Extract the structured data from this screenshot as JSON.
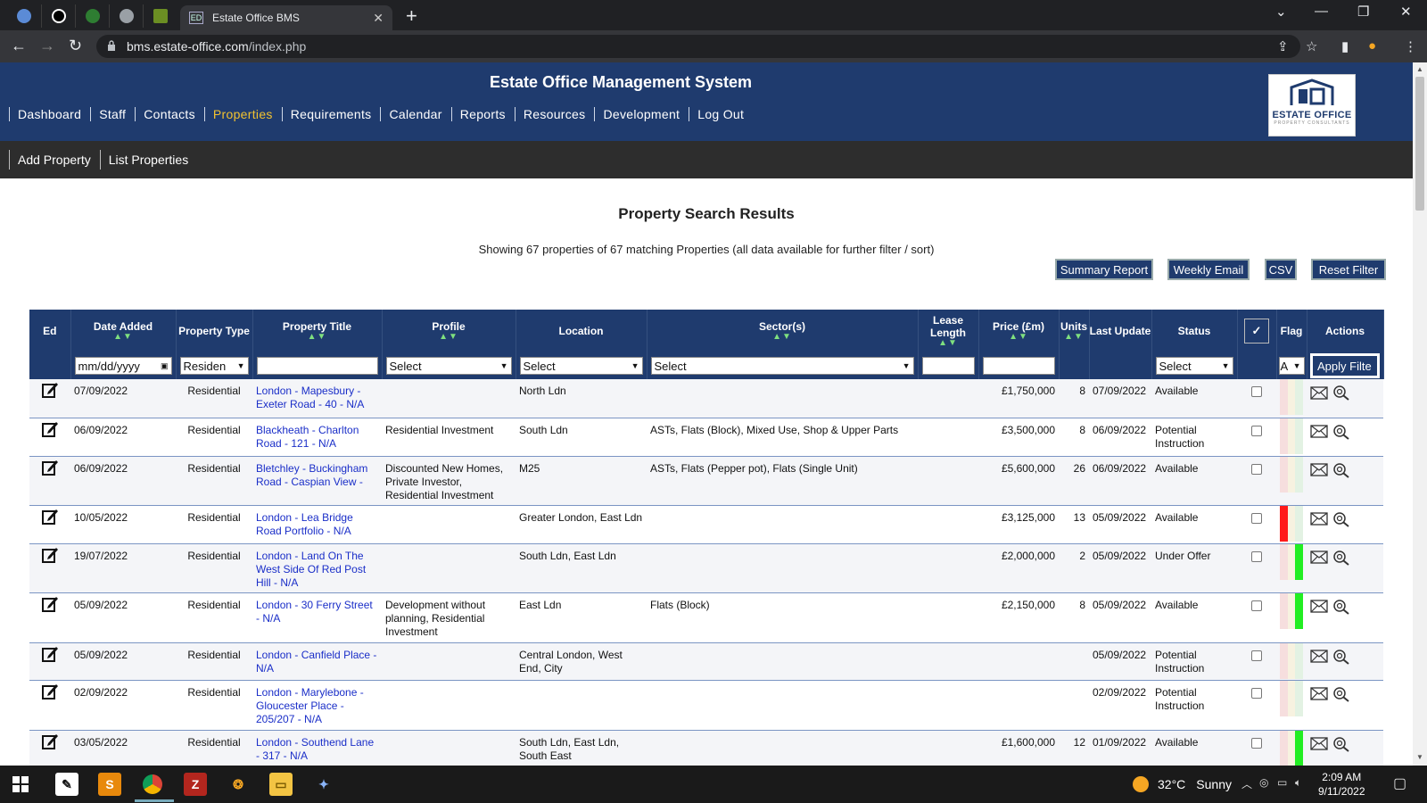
{
  "browser": {
    "active_tab_title": "Estate Office BMS",
    "url_host": "bms.estate-office.com",
    "url_path": "/index.php",
    "pinned_tabs": [
      "tab-1",
      "tab-2",
      "tab-3",
      "tab-4",
      "tab-5"
    ]
  },
  "site": {
    "title": "Estate Office Management System",
    "logo_text": "ESTATE OFFICE",
    "logo_subtext": "PROPERTY CONSULTANTS",
    "nav": [
      "Dashboard",
      "Staff",
      "Contacts",
      "Properties",
      "Requirements",
      "Calendar",
      "Reports",
      "Resources",
      "Development",
      "Log Out"
    ],
    "nav_active": "Properties",
    "subnav": [
      "Add Property",
      "List Properties"
    ]
  },
  "results": {
    "title": "Property Search Results",
    "summary": "Showing 67 properties of 67 matching Properties (all data available for further filter / sort)",
    "buttons": {
      "summary_report": "Summary Report",
      "weekly_email": "Weekly Email",
      "csv": "CSV",
      "reset_filter": "Reset Filter"
    }
  },
  "table": {
    "headers": {
      "ed": "Ed",
      "date_added": "Date Added",
      "property_type": "Property Type",
      "property_title": "Property Title",
      "profile": "Profile",
      "location": "Location",
      "sectors": "Sector(s)",
      "lease_length": "Lease Length",
      "price": "Price (£m)",
      "units": "Units",
      "last_update": "Last Update",
      "status": "Status",
      "check_all": "✓",
      "flag": "Flag",
      "actions": "Actions"
    },
    "sort_arrows": "▲▼",
    "filters": {
      "date_placeholder": "mm/dd/yyyy",
      "property_type_value": "Residen",
      "profile_value": "Select",
      "location_value": "Select",
      "sectors_value": "Select",
      "status_value": "Select",
      "flag_value": "A",
      "apply_label": "Apply Filte"
    },
    "rows": [
      {
        "date": "07/09/2022",
        "type": "Residential",
        "title": "London - Mapesbury - Exeter Road - 40 - N/A",
        "profile": "",
        "location": "North Ldn",
        "sectors": "",
        "price": "£1,750,000",
        "units": "8",
        "last_update": "07/09/2022",
        "status": "Available",
        "flag_colors": [
          "#f6dede",
          "#f7f2e0",
          "#e3f2e3"
        ]
      },
      {
        "date": "06/09/2022",
        "type": "Residential",
        "title": "Blackheath - Charlton Road - 121 - N/A",
        "profile": "Residential Investment",
        "location": "South Ldn",
        "sectors": "ASTs, Flats (Block), Mixed Use, Shop & Upper Parts",
        "price": "£3,500,000",
        "units": "8",
        "last_update": "06/09/2022",
        "status": "Potential Instruction",
        "flag_colors": [
          "#f6dede",
          "#f7f2e0",
          "#e3f2e3"
        ]
      },
      {
        "date": "06/09/2022",
        "type": "Residential",
        "title": "Bletchley - Buckingham Road - Caspian View -",
        "profile": "Discounted New Homes, Private Investor, Residential Investment",
        "location": "M25",
        "sectors": "ASTs, Flats (Pepper pot), Flats (Single Unit)",
        "price": "£5,600,000",
        "units": "26",
        "last_update": "06/09/2022",
        "status": "Available",
        "flag_colors": [
          "#f6dede",
          "#f7f2e0",
          "#e3f2e3"
        ]
      },
      {
        "date": "10/05/2022",
        "type": "Residential",
        "title": "London - Lea Bridge Road Portfolio - N/A",
        "profile": "",
        "location": "Greater London, East Ldn",
        "sectors": "",
        "price": "£3,125,000",
        "units": "13",
        "last_update": "05/09/2022",
        "status": "Available",
        "flag_colors": [
          "#ff1a1a",
          "#f7f2e0",
          "#e3f2e3"
        ]
      },
      {
        "date": "19/07/2022",
        "type": "Residential",
        "title": "London - Land On The West Side Of Red Post Hill - N/A",
        "profile": "",
        "location": "South Ldn, East Ldn",
        "sectors": "",
        "price": "£2,000,000",
        "units": "2",
        "last_update": "05/09/2022",
        "status": "Under Offer",
        "flag_colors": [
          "#f6dede",
          "#f7f2e0",
          "#22ee22"
        ]
      },
      {
        "date": "05/09/2022",
        "type": "Residential",
        "title": "London - 30 Ferry Street - N/A",
        "profile": "Development without planning, Residential Investment",
        "location": "East Ldn",
        "sectors": "Flats (Block)",
        "price": "£2,150,000",
        "units": "8",
        "last_update": "05/09/2022",
        "status": "Available",
        "flag_colors": [
          "#f6dede",
          "#f7f2e0",
          "#22ee22"
        ]
      },
      {
        "date": "05/09/2022",
        "type": "Residential",
        "title": "London - Canfield Place - N/A",
        "profile": "",
        "location": "Central London, West End, City",
        "sectors": "",
        "price": "",
        "units": "",
        "last_update": "05/09/2022",
        "status": "Potential Instruction",
        "flag_colors": [
          "#f6dede",
          "#f7f2e0",
          "#e3f2e3"
        ]
      },
      {
        "date": "02/09/2022",
        "type": "Residential",
        "title": "London - Marylebone - Gloucester Place - 205/207 - N/A",
        "profile": "",
        "location": "",
        "sectors": "",
        "price": "",
        "units": "",
        "last_update": "02/09/2022",
        "status": "Potential Instruction",
        "flag_colors": [
          "#f6dede",
          "#f7f2e0",
          "#e3f2e3"
        ]
      },
      {
        "date": "03/05/2022",
        "type": "Residential",
        "title": "London - Southend Lane - 317 - N/A",
        "profile": "",
        "location": "South Ldn, East Ldn, South East",
        "sectors": "",
        "price": "£1,600,000",
        "units": "12",
        "last_update": "01/09/2022",
        "status": "Available",
        "flag_colors": [
          "#f6dede",
          "#f7f2e0",
          "#22ee22"
        ]
      }
    ]
  },
  "taskbar": {
    "temperature": "32°C",
    "weather": "Sunny",
    "time": "2:09 AM",
    "date": "9/11/2022"
  },
  "colors": {
    "header_blue": "#1f3b6e",
    "subnav_dark": "#2d2d2d",
    "nav_active": "#f2c230",
    "link_blue": "#1a2ec8",
    "sort_green": "#7fe07f"
  }
}
